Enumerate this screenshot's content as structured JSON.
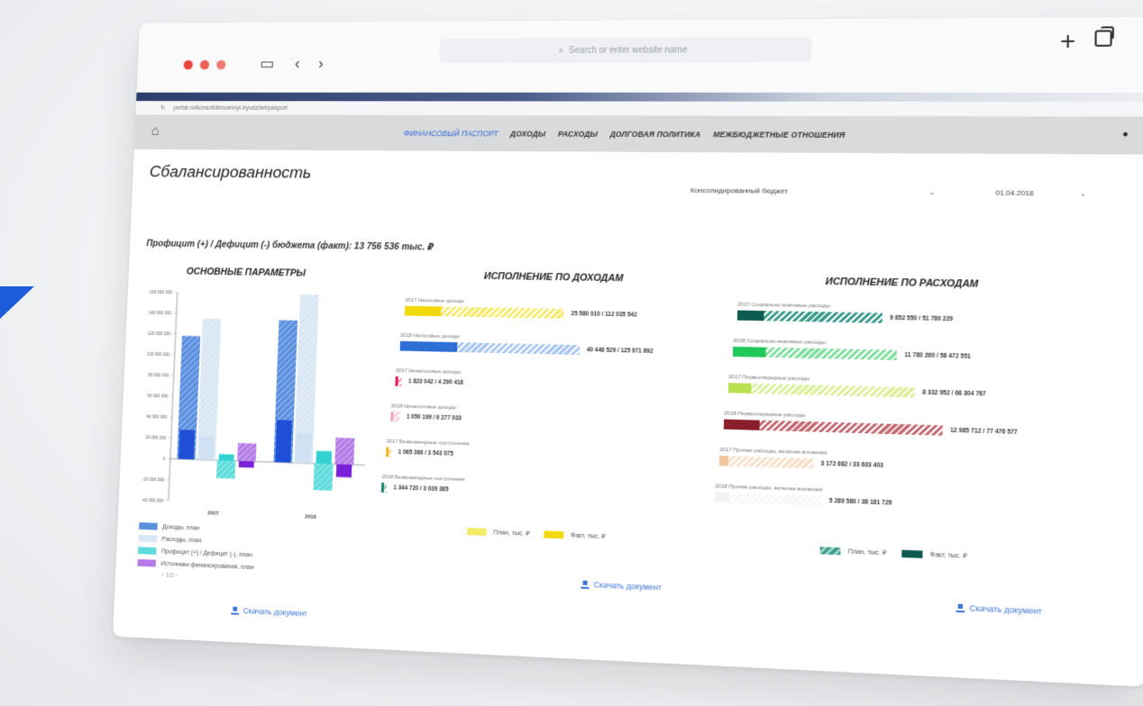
{
  "browser": {
    "search_placeholder": "Search or enter website name",
    "address": "portal.ru/konsolidirovannyi-byudzhet/pasport"
  },
  "nav": {
    "items": [
      {
        "label": "Финансовый паспорт",
        "active": true
      },
      {
        "label": "Доходы",
        "active": false
      },
      {
        "label": "Расходы",
        "active": false
      },
      {
        "label": "Долговая политика",
        "active": false
      },
      {
        "label": "Межбюджетные отношения",
        "active": false
      }
    ]
  },
  "page": {
    "title": "Сбалансированность",
    "budget_select": "Консолидированный бюджет",
    "date_select": "01.04.2018",
    "summary": "Профицит (+) / Дефицит (-) бюджета (факт): 13 756 536 тыс. ₽",
    "download_label": "Скачать документ"
  },
  "sections": {
    "main": "ОСНОВНЫЕ ПАРАМЕТРЫ",
    "income": "ИСПОЛНЕНИЕ ПО ДОХОДАМ",
    "expense": "ИСПОЛНЕНИЕ ПО РАСХОДАМ"
  },
  "colors": {
    "accent": "#2a63d6",
    "income_plan": "#f5ea6a",
    "income_fact": "#f2d90c",
    "expense_plan_legend": "#3c9c8c",
    "expense_fact_legend": "#0d5a50"
  },
  "main_legend": [
    {
      "label": "Доходы, план",
      "color": "#5b8fe0"
    },
    {
      "label": "Расходы, план",
      "color": "#d9e7f5"
    },
    {
      "label": "Профицит (+) / Дефицит (-), план",
      "color": "#5fdcdc"
    },
    {
      "label": "Источники финансирования, план",
      "color": "#b57be8"
    }
  ],
  "main_pager": "‹ 1/2 ›",
  "income_legend": {
    "plan": "План, тыс. ₽",
    "fact": "Факт, тыс. ₽"
  },
  "expense_legend": {
    "plan": "План, тыс. ₽",
    "fact": "Факт, тыс. ₽"
  },
  "chart_data": [
    {
      "type": "bar",
      "title": "ОСНОВНЫЕ ПАРАМЕТРЫ",
      "categories": [
        "2017",
        "2018"
      ],
      "ylim": [
        -40000000,
        160000000
      ],
      "yticks": [
        "160 000 000",
        "140 000 000",
        "120 000 000",
        "100 000 000",
        "80 000 000",
        "60 000 000",
        "40 000 000",
        "20 000 000",
        "0",
        "-20 000 000",
        "-40 000 000"
      ],
      "series": [
        {
          "name": "Доходы, план",
          "values": [
            118000000,
            135000000
          ],
          "fact": [
            28000000,
            40000000
          ],
          "color": "#5b8fe0",
          "fact_color": "#1f4fd6"
        },
        {
          "name": "Расходы, план",
          "values": [
            135000000,
            160000000
          ],
          "fact": [
            22000000,
            28000000
          ],
          "color": "#d9e7f5",
          "fact_color": "#cfe1f3"
        },
        {
          "name": "Профицит (+) / Дефицит (-), план",
          "values": [
            -17000000,
            -25000000
          ],
          "fact": [
            6000000,
            12000000
          ],
          "color": "#5fdcdc",
          "fact_color": "#33d3d3"
        },
        {
          "name": "Источники финансирования, план",
          "values": [
            17000000,
            25000000
          ],
          "fact": [
            -6000000,
            -12000000
          ],
          "color": "#b57be8",
          "fact_color": "#7a22d8"
        }
      ]
    },
    {
      "type": "bar",
      "orientation": "horizontal",
      "title": "ИСПОЛНЕНИЕ ПО ДОХОДАМ",
      "items": [
        {
          "label": "2017 Налоговые доходы",
          "plan": 112035542,
          "fact": 25580010,
          "value_text": "25 580 010 / 112 035 542",
          "color": "#f2d90c",
          "plan_color": "#f5ea6a"
        },
        {
          "label": "2018 Налоговые доходы",
          "plan": 125971692,
          "fact": 40446529,
          "value_text": "40 446 529 / 125 971 692",
          "color": "#2e6fd6",
          "plan_color": "#a9c6f0"
        },
        {
          "label": "2017 Неналоговые доходы",
          "plan": 4290418,
          "fact": 1823042,
          "value_text": "1 823 042 / 4 290 418",
          "color": "#e0174f",
          "plan_color": "#f4a0b8"
        },
        {
          "label": "2018 Неналоговые доходы",
          "plan": 6277033,
          "fact": 1050199,
          "value_text": "1 050 199 / 6 277 033",
          "color": "#f0a4c0",
          "plan_color": "#f7cfdd"
        },
        {
          "label": "2017 Безвозмездные поступления",
          "plan": 3543075,
          "fact": 1065366,
          "value_text": "1 065 366 / 3 543 075",
          "color": "#f0b820",
          "plan_color": "#f7da8a"
        },
        {
          "label": "2018 Безвозмездные поступления",
          "plan": 3039385,
          "fact": 1344720,
          "value_text": "1 344 720 / 3 039 385",
          "color": "#1e8070",
          "plan_color": "#9ccfc6"
        }
      ]
    },
    {
      "type": "bar",
      "orientation": "horizontal",
      "title": "ИСПОЛНЕНИЕ ПО РАСХОДАМ",
      "items": [
        {
          "label": "2017 Социально-значимые расходы",
          "plan": 51780229,
          "fact": 9652550,
          "value_text": "9 652 550 / 51 780 229",
          "color": "#0d5a50",
          "plan_color": "#3c9c8c"
        },
        {
          "label": "2018 Социально-значимые расходы",
          "plan": 58472551,
          "fact": 11780260,
          "value_text": "11 780 260 / 58 472 551",
          "color": "#21c95a",
          "plan_color": "#7fe09f"
        },
        {
          "label": "2017 Первоочередные расходы",
          "plan": 66304767,
          "fact": 8332952,
          "value_text": "8 332 952 / 66 304 767",
          "color": "#b8e050",
          "plan_color": "#dcf09a"
        },
        {
          "label": "2018 Первоочередные расходы",
          "plan": 77476577,
          "fact": 12985712,
          "value_text": "12 985 712 / 77 476 577",
          "color": "#8a1e2a",
          "plan_color": "#c46a72"
        },
        {
          "label": "2017 Прочие расходы, включая вложения",
          "plan": 33633403,
          "fact": 3172682,
          "value_text": "3 172 682 / 33 633 403",
          "color": "#f2c69a",
          "plan_color": "#f8e0c8"
        },
        {
          "label": "2018 Прочие расходы, включая вложения",
          "plan": 38181729,
          "fact": 5289580,
          "value_text": "5 289 580 / 38 181 729",
          "color": "#f3f3f3",
          "plan_color": "#f7f7f7"
        }
      ]
    }
  ]
}
